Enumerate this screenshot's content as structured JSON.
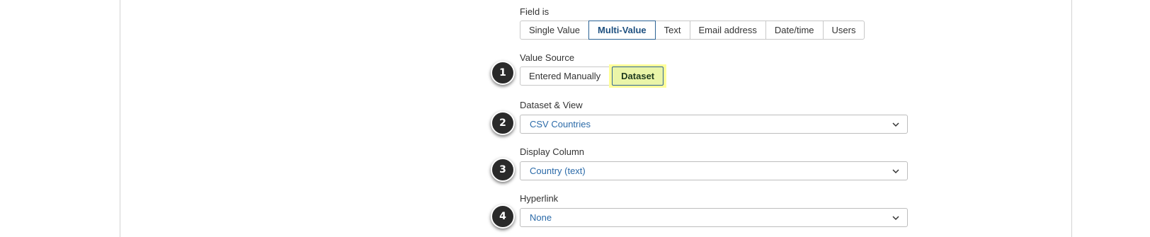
{
  "field_is": {
    "label": "Field is",
    "options": [
      "Single Value",
      "Multi-Value",
      "Text",
      "Email address",
      "Date/time",
      "Users"
    ],
    "selected": "Multi-Value"
  },
  "value_source": {
    "label": "Value Source",
    "options": [
      "Entered Manually",
      "Dataset"
    ],
    "selected": "Dataset"
  },
  "dataset_view": {
    "label": "Dataset & View",
    "value": "CSV Countries"
  },
  "display_column": {
    "label": "Display Column",
    "value": "Country (text)"
  },
  "hyperlink": {
    "label": "Hyperlink",
    "value": "None"
  },
  "badges": [
    "1",
    "2",
    "3",
    "4"
  ],
  "colors": {
    "highlight": "#ffff99",
    "accent": "#2d6495",
    "link_text": "#2b6aa8",
    "badge": "#2a2a2a"
  }
}
